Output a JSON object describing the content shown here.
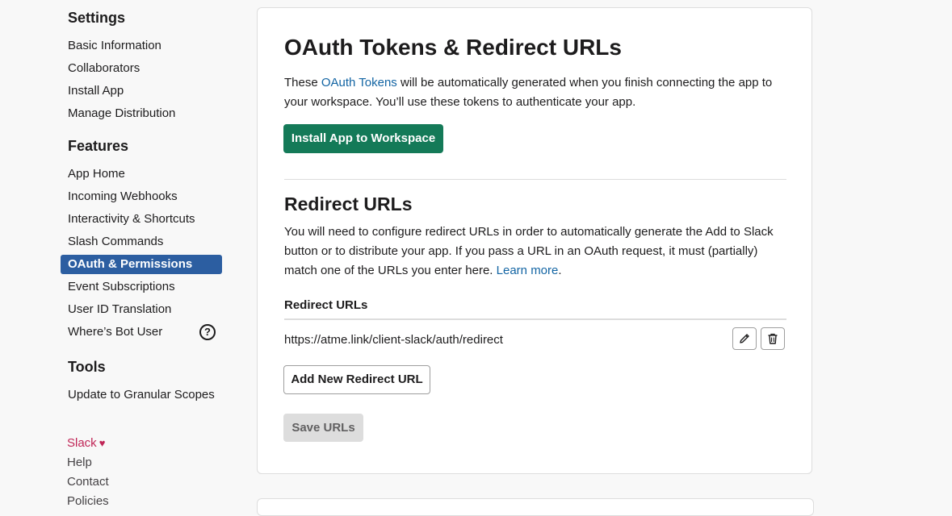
{
  "sidebar": {
    "settings_title": "Settings",
    "settings_items": [
      "Basic Information",
      "Collaborators",
      "Install App",
      "Manage Distribution"
    ],
    "features_title": "Features",
    "features_items": [
      "App Home",
      "Incoming Webhooks",
      "Interactivity & Shortcuts",
      "Slash Commands",
      "OAuth & Permissions",
      "Event Subscriptions",
      "User ID Translation",
      "Where’s Bot User"
    ],
    "active_item": "OAuth & Permissions",
    "help_icon": "?",
    "tools_title": "Tools",
    "tools_items": [
      "Update to Granular Scopes"
    ],
    "footer": [
      "Slack",
      "Help",
      "Contact",
      "Policies"
    ]
  },
  "card": {
    "title": "OAuth Tokens & Redirect URLs",
    "intro_before": "These ",
    "intro_link": "OAuth Tokens",
    "intro_after": " will be automatically generated when you finish connecting the app to your workspace. You’ll use these tokens to authenticate your app.",
    "install_button": "Install App to Workspace",
    "redirect_title": "Redirect URLs",
    "redirect_desc": "You will need to configure redirect URLs in order to automatically generate the Add to Slack button or to distribute your app. If you pass a URL in an OAuth request, it must (partially) match one of the URLs you enter here. ",
    "redirect_link": "Learn more",
    "redirect_period": ".",
    "field_label": "Redirect URLs",
    "redirect_url": "https://atme.link/client-slack/auth/redirect",
    "add_button": "Add New Redirect URL",
    "save_button": "Save URLs"
  },
  "icons": {
    "edit": "pencil-icon",
    "delete": "trash-icon",
    "heart": "heart-icon"
  },
  "colors": {
    "primary_button": "#147a58",
    "active_nav": "#2c5ea1",
    "link": "#1264a3",
    "slack_brand": "#c02657"
  }
}
